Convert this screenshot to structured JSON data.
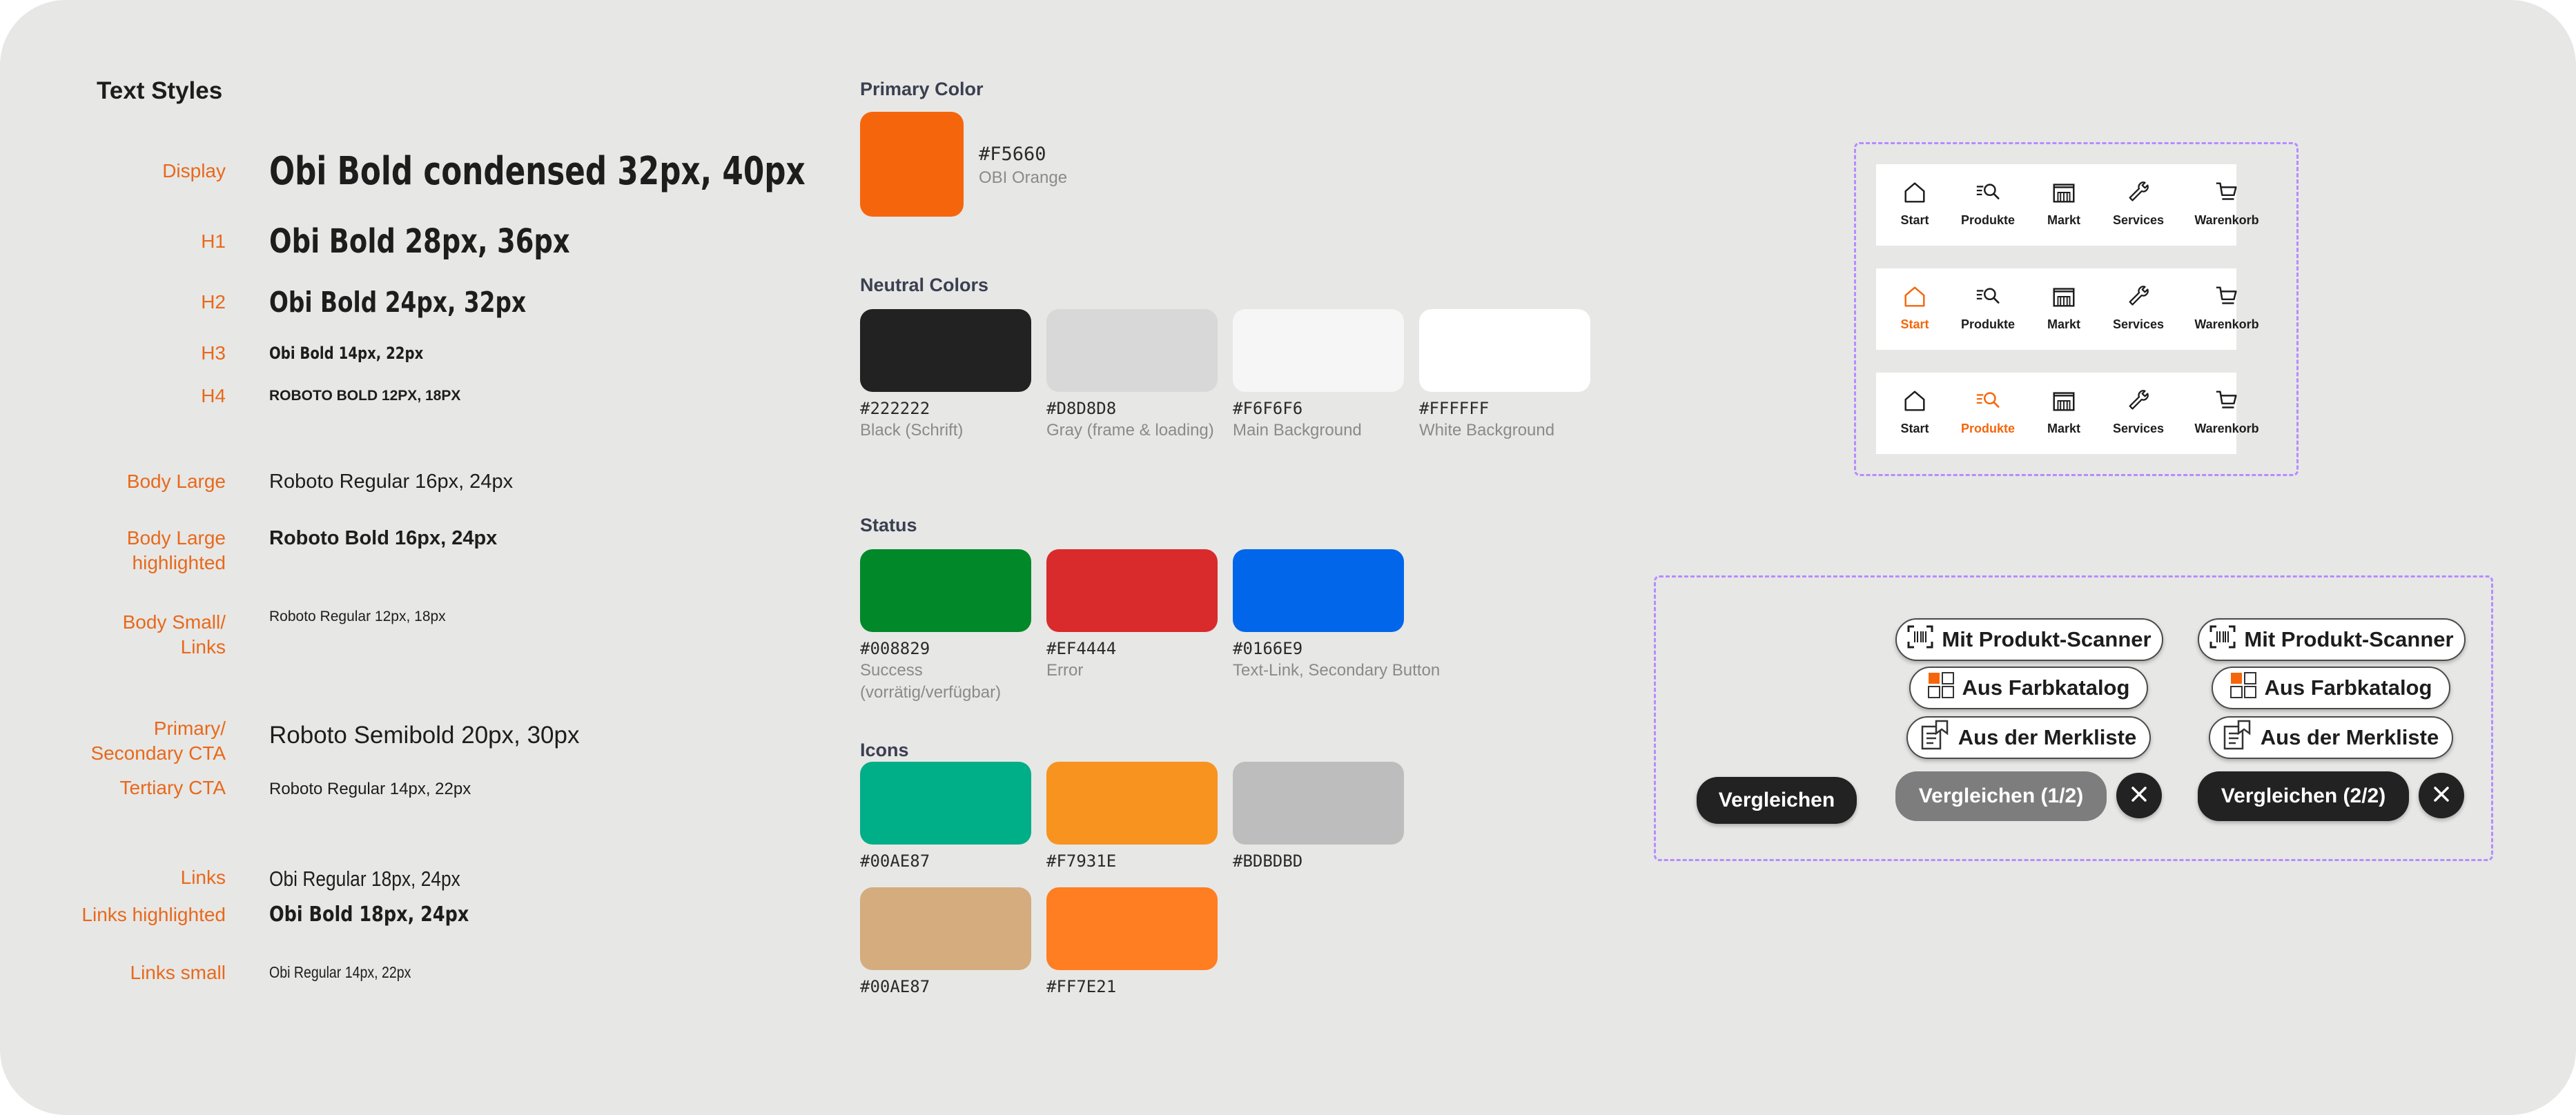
{
  "text_styles": {
    "title": "Text Styles",
    "rows": [
      {
        "label": "Display",
        "sample": "Obi Bold condensed 32px, 40px"
      },
      {
        "label": "H1",
        "sample": "Obi Bold 28px, 36px"
      },
      {
        "label": "H2",
        "sample": "Obi Bold 24px, 32px"
      },
      {
        "label": "H3",
        "sample": "Obi Bold 14px, 22px"
      },
      {
        "label": "H4",
        "sample": "ROBOTO BOLD 12PX, 18PX"
      },
      {
        "label": "Body Large",
        "sample": "Roboto Regular 16px, 24px"
      },
      {
        "label_line1": "Body Large",
        "label_line2": "highlighted",
        "sample": "Roboto Bold 16px, 24px"
      },
      {
        "label_line1": "Body Small/",
        "label_line2": "Links",
        "sample": "Roboto Regular 12px, 18px"
      },
      {
        "label_line1": "Primary/",
        "label_line2": "Secondary CTA",
        "sample": "Roboto Semibold 20px, 30px"
      },
      {
        "label": "Tertiary CTA",
        "sample": "Roboto Regular 14px, 22px"
      },
      {
        "label": "Links",
        "sample": "Obi Regular 18px, 24px"
      },
      {
        "label": "Links highlighted",
        "sample": "Obi Bold 18px, 24px"
      },
      {
        "label": "Links small",
        "sample": "Obi Regular 14px, 22px"
      }
    ]
  },
  "colors": {
    "primary": {
      "title": "Primary Color",
      "swatches": [
        {
          "hex": "#F5660",
          "name": "OBI Orange",
          "color": "#f5660c"
        }
      ]
    },
    "neutral": {
      "title": "Neutral Colors",
      "swatches": [
        {
          "hex": "#222222",
          "name": "Black (Schrift)",
          "color": "#222222"
        },
        {
          "hex": "#D8D8D8",
          "name": "Gray (frame & loading)",
          "color": "#d8d8d8"
        },
        {
          "hex": "#F6F6F6",
          "name": "Main Background",
          "color": "#f6f6f6"
        },
        {
          "hex": "#FFFFFF",
          "name": "White Background",
          "color": "#ffffff"
        }
      ]
    },
    "status": {
      "title": "Status",
      "swatches": [
        {
          "hex": "#008829",
          "name_line1": "Success",
          "name_line2": "(vorrätig/verfügbar)",
          "color": "#008829"
        },
        {
          "hex": "#EF4444",
          "name": "Error",
          "color": "#d92b2b"
        },
        {
          "hex": "#0166E9",
          "name": "Text-Link, Secondary Button",
          "color": "#0166e9"
        }
      ]
    },
    "icons": {
      "title": "Icons",
      "swatches": [
        {
          "hex": "#00AE87",
          "color": "#00ae87"
        },
        {
          "hex": "#F7931E",
          "color": "#f7931e"
        },
        {
          "hex": "#BDBDBD",
          "color": "#bdbdbd"
        },
        {
          "hex": "#00AE87",
          "color": "#d4ac7e"
        },
        {
          "hex": "#FF7E21",
          "color": "#ff7e21"
        }
      ]
    }
  },
  "navigation": {
    "items": [
      "Start",
      "Produkte",
      "Markt",
      "Services",
      "Warenkorb"
    ],
    "variants": [
      {
        "active": "none"
      },
      {
        "active": "Start"
      },
      {
        "active": "Produkte"
      }
    ],
    "accent": "#f5660c"
  },
  "compare": {
    "standalone_button": "Vergleichen",
    "options": [
      "Mit Produkt-Scanner",
      "Aus Farbkatalog",
      "Aus der Merkliste"
    ],
    "state_1": "Vergleichen (1/2)",
    "state_2": "Vergleichen (2/2)",
    "close_icon": "close-icon"
  }
}
